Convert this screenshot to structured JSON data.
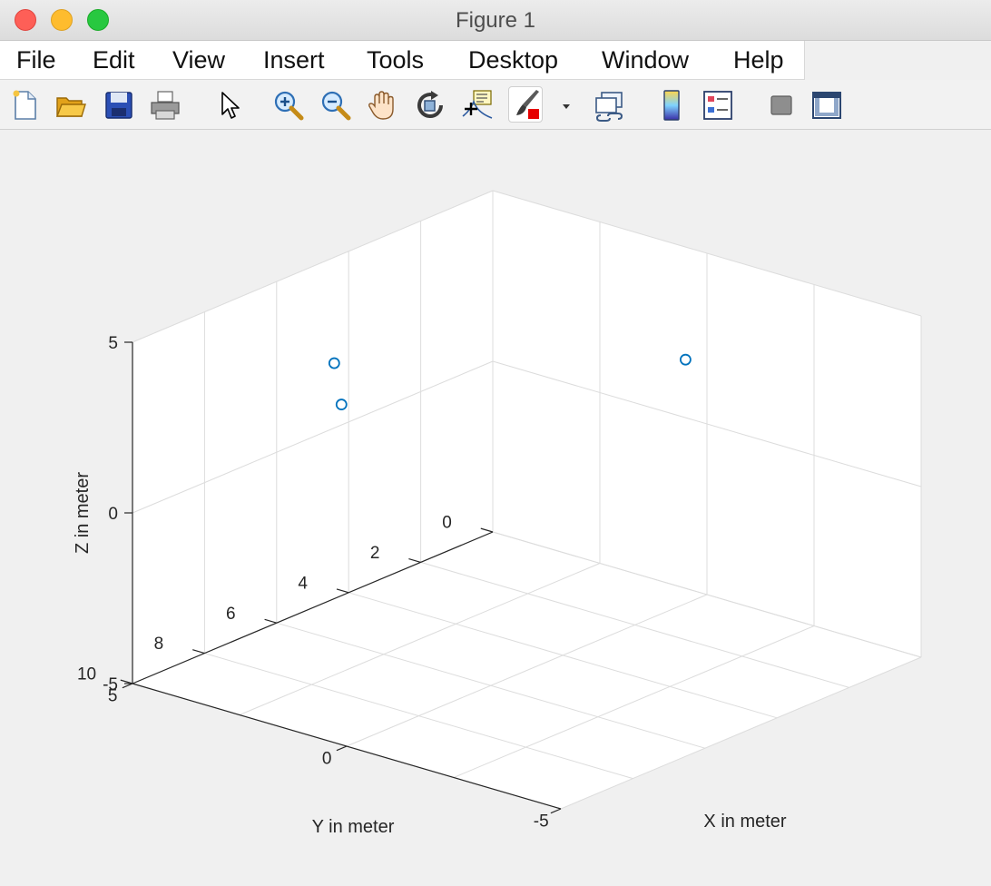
{
  "window": {
    "title": "Figure 1"
  },
  "menu": {
    "items": [
      "File",
      "Edit",
      "View",
      "Insert",
      "Tools",
      "Desktop",
      "Window",
      "Help"
    ]
  },
  "toolbar": {
    "tools": [
      "new-figure-icon",
      "open-file-icon",
      "save-icon",
      "print-icon",
      "edit-plot-arrow-icon",
      "zoom-in-icon",
      "zoom-out-icon",
      "pan-hand-icon",
      "rotate-3d-icon",
      "data-cursor-icon",
      "brush-icon",
      "brush-dropdown-icon",
      "link-plot-icon",
      "colorbar-icon",
      "legend-icon",
      "hide-plot-tools-icon",
      "show-plot-tools-icon"
    ],
    "accent_colors": {
      "brush_red": "#e60000",
      "save_blue": "#1f3f9f",
      "folder_yellow": "#f4b400"
    }
  },
  "chart_data": {
    "type": "scatter3d",
    "title": "",
    "xlabel": "X in meter",
    "ylabel": "Y in meter",
    "zlabel": "Z in meter",
    "xlim": [
      -5,
      5
    ],
    "ylim": [
      0,
      10
    ],
    "zlim": [
      -5,
      5
    ],
    "x_ticks": [
      -5,
      0,
      5
    ],
    "y_ticks": [
      0,
      2,
      4,
      6,
      8,
      10
    ],
    "z_ticks": [
      -5,
      0,
      5
    ],
    "x_direction": "reversed",
    "grid": true,
    "marker": "circle",
    "marker_color": "#0072bd",
    "series": [
      {
        "points": [
          {
            "x": 5.0,
            "y": 4.4,
            "z": 1.9
          },
          {
            "x": 5.0,
            "y": 4.2,
            "z": 0.6
          },
          {
            "x": 0.5,
            "y": 0.0,
            "z": 1.7
          }
        ]
      }
    ]
  }
}
